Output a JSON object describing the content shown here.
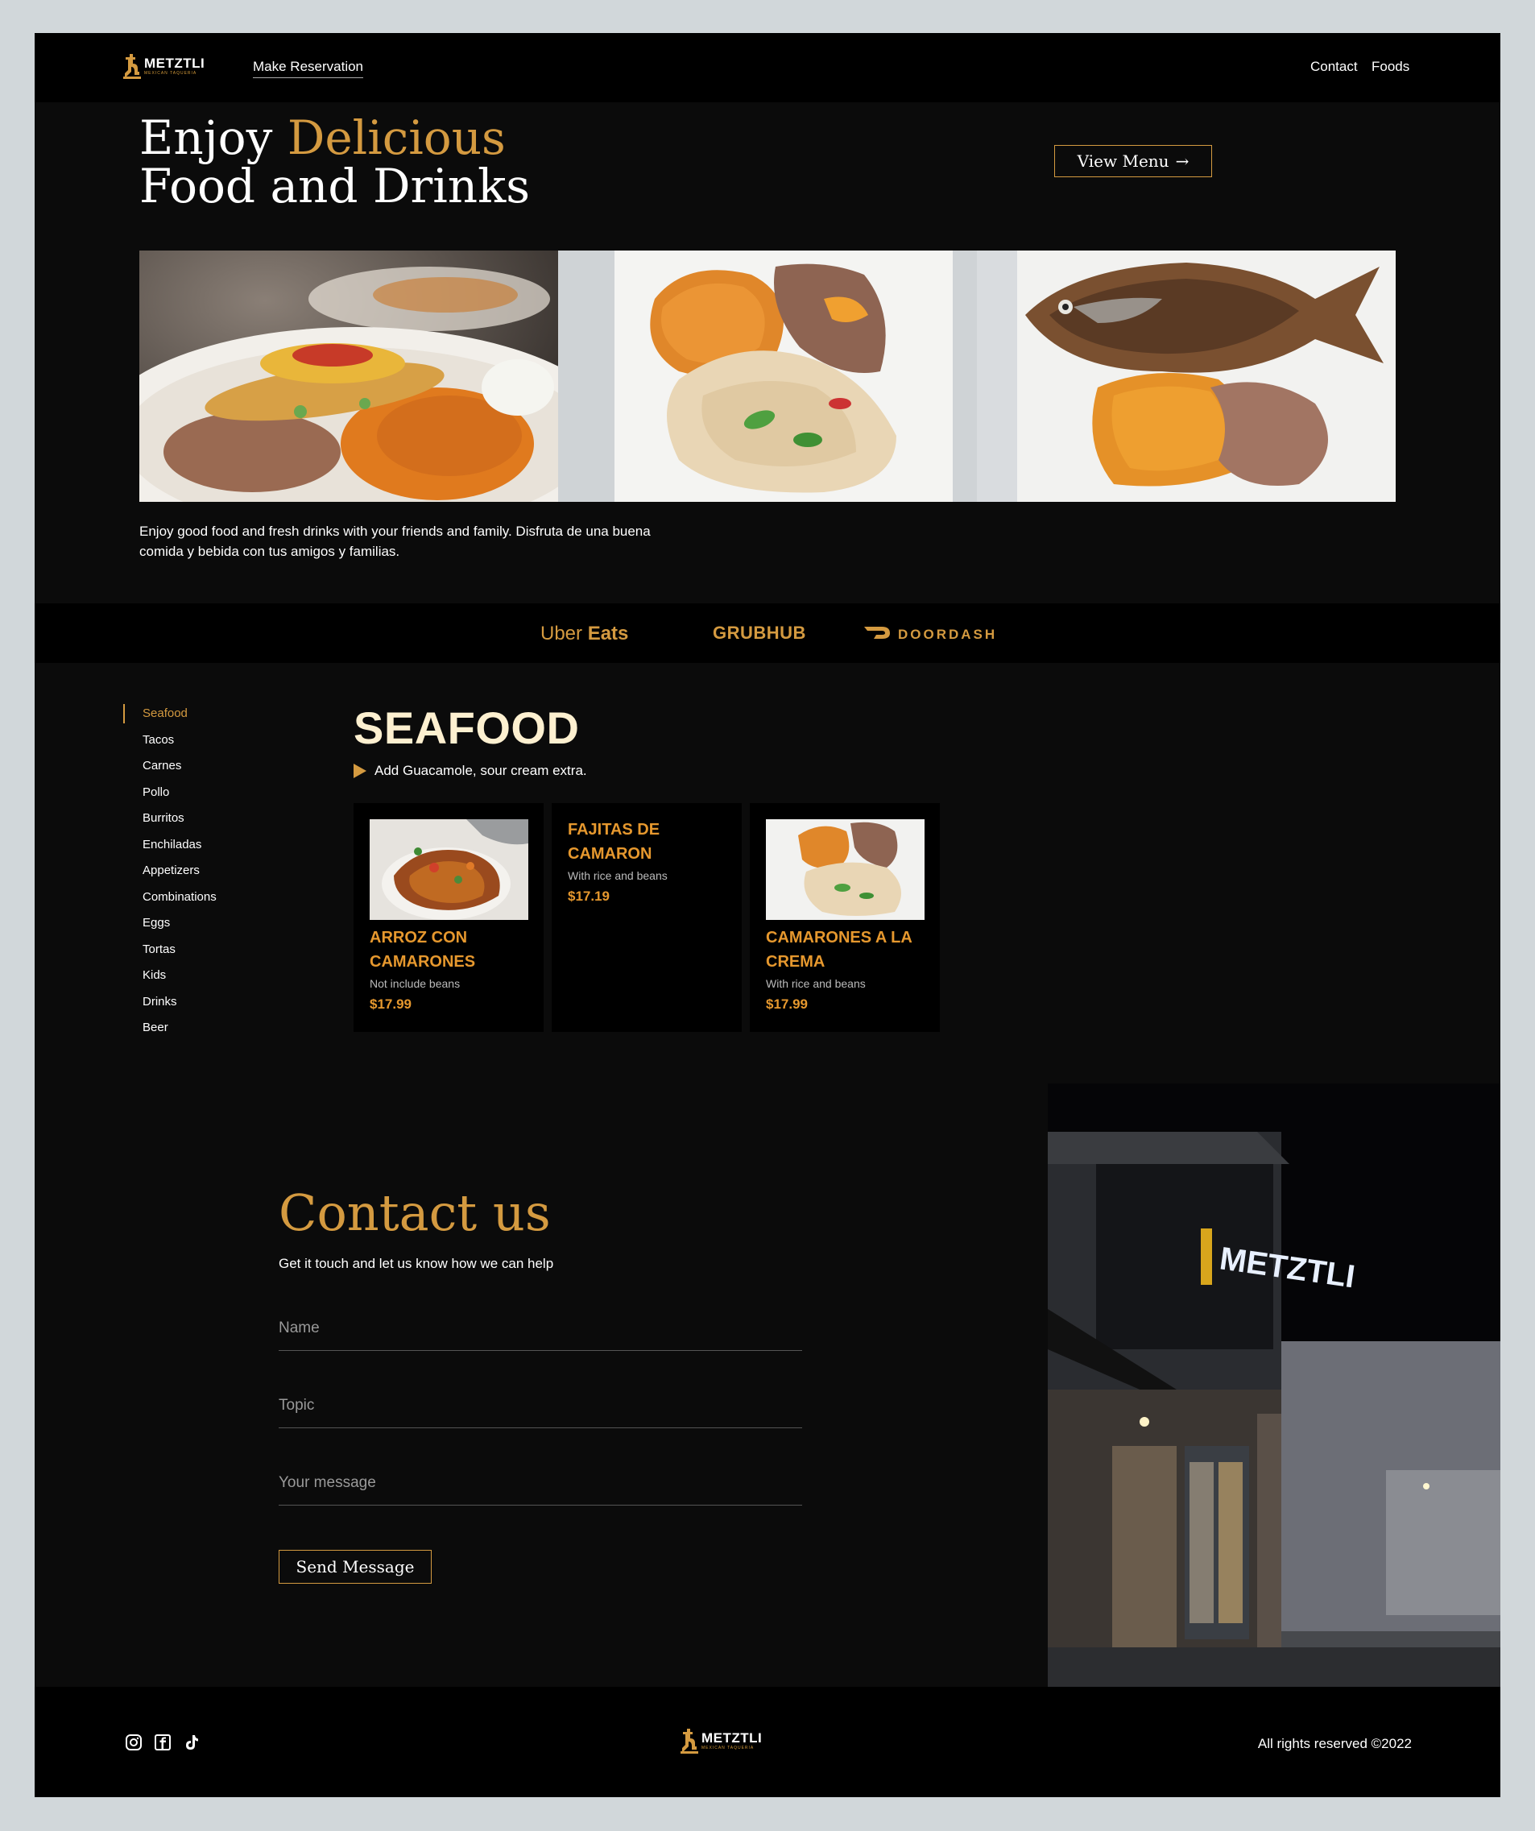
{
  "nav": {
    "logo_word": "METZTLI",
    "logo_sub": "MEXICAN TAQUERIA",
    "reservation": "Make Reservation",
    "contact": "Contact",
    "foods": "Foods"
  },
  "hero": {
    "title_1a": "Enjoy ",
    "title_1b": "Delicious",
    "title_2": "Food and Drinks",
    "view_menu": "View Menu",
    "description": "Enjoy good food and fresh drinks with your friends and family. Disfruta de una buena comida y bebida con tus amigos y familias."
  },
  "delivery": {
    "uber_a": "Uber",
    "uber_b": "Eats",
    "grubhub": "GRUBHUB",
    "doordash": "DOORDASH"
  },
  "categories": [
    "Seafood",
    "Tacos",
    "Carnes",
    "Pollo",
    "Burritos",
    "Enchiladas",
    "Appetizers",
    "Combinations",
    "Eggs",
    "Tortas",
    "Kids",
    "Drinks",
    "Beer"
  ],
  "menu": {
    "title": "SEAFOOD",
    "note": "Add Guacamole, sour cream extra.",
    "items": [
      {
        "name": "Arroz con camarones",
        "desc": "Not include beans",
        "price": "$17.99"
      },
      {
        "name": "Fajitas de camaron",
        "desc": "With rice and beans",
        "price": "$17.19"
      },
      {
        "name": "Camarones a la crema",
        "desc": "With rice and beans",
        "price": "$17.99"
      }
    ]
  },
  "contact": {
    "title": "Contact us",
    "subtitle": "Get it touch and let us know how we can help",
    "name_placeholder": "Name",
    "topic_placeholder": "Topic",
    "message_placeholder": "Your message",
    "send": "Send Message"
  },
  "footer": {
    "copyright": "All rights reserved ©2022"
  },
  "colors": {
    "accent": "#d49a40",
    "background": "#0b0b0b",
    "bar": "#000000"
  }
}
